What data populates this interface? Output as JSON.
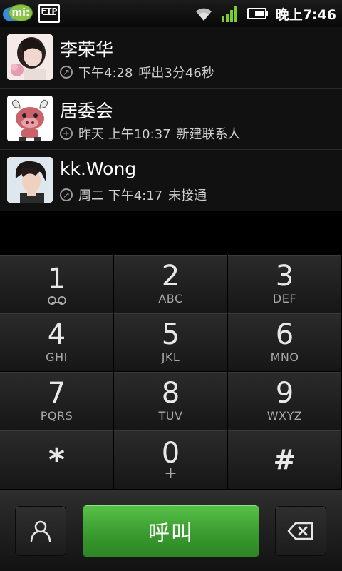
{
  "status_bar": {
    "mi_badge": "mi:",
    "ftp_badge": "FTP",
    "time": "晚上7:46"
  },
  "call_log": [
    {
      "name": "李荣华",
      "call_icon": "outgoing-arrow-icon",
      "time": "下午4:28",
      "detail": "呼出3分46秒"
    },
    {
      "name": "居委会",
      "call_icon": "add-contact-icon",
      "time": "昨天 上午10:37",
      "detail": "新建联系人"
    },
    {
      "name": "kk.Wong",
      "call_icon": "missed-arrow-icon",
      "time": "周二 下午4:17",
      "detail": "未接通"
    }
  ],
  "dialpad": {
    "keys": [
      {
        "digit": "1",
        "letters": ""
      },
      {
        "digit": "2",
        "letters": "ABC"
      },
      {
        "digit": "3",
        "letters": "DEF"
      },
      {
        "digit": "4",
        "letters": "GHI"
      },
      {
        "digit": "5",
        "letters": "JKL"
      },
      {
        "digit": "6",
        "letters": "MNO"
      },
      {
        "digit": "7",
        "letters": "PQRS"
      },
      {
        "digit": "8",
        "letters": "TUV"
      },
      {
        "digit": "9",
        "letters": "WXYZ"
      },
      {
        "digit": "*",
        "letters": ""
      },
      {
        "digit": "0",
        "letters": "+"
      },
      {
        "digit": "#",
        "letters": ""
      }
    ]
  },
  "actions": {
    "call_label": "呼叫"
  },
  "colors": {
    "call_green": "#3a9b2f",
    "background": "#000000"
  }
}
